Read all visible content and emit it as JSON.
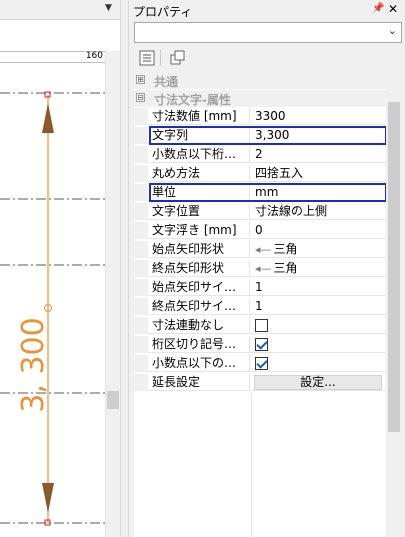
{
  "drawing": {
    "ruler_value": "160",
    "dimension_text": "3, 300",
    "colors": {
      "dimension": "#e8943a",
      "arrow": "#8a5a2b",
      "node": "#e02020"
    }
  },
  "panel": {
    "title": "プロパティ",
    "pin_icon": "pin-icon",
    "close_icon": "close-icon",
    "object_select_value": ""
  },
  "categories": [
    {
      "label": "共通",
      "expander": "⊞"
    },
    {
      "label": "寸法文字-属性",
      "expander": "⊟"
    }
  ],
  "properties": [
    {
      "name": "寸法数値 [mm]",
      "value": "3300"
    },
    {
      "name": "文字列",
      "value": "3,300",
      "highlighted": true
    },
    {
      "name": "小数点以下桁…",
      "value": "2"
    },
    {
      "name": "丸め方法",
      "value": "四捨五入"
    },
    {
      "name": "単位",
      "value": "mm",
      "highlighted": true
    },
    {
      "name": "文字位置",
      "value": "寸法線の上側"
    },
    {
      "name": "文字浮き [mm]",
      "value": "0"
    },
    {
      "name": "始点矢印形状",
      "value": "三角",
      "arrow": true
    },
    {
      "name": "終点矢印形状",
      "value": "三角",
      "arrow": true
    },
    {
      "name": "始点矢印サイ…",
      "value": "1"
    },
    {
      "name": "終点矢印サイ…",
      "value": "1"
    },
    {
      "name": "寸法連動なし",
      "checkbox": false
    },
    {
      "name": "桁区切り記号…",
      "checkbox": true
    },
    {
      "name": "小数点以下の…",
      "checkbox": true
    },
    {
      "name": "延長設定",
      "button": "設定..."
    }
  ],
  "accent_color": "#1a30b0"
}
